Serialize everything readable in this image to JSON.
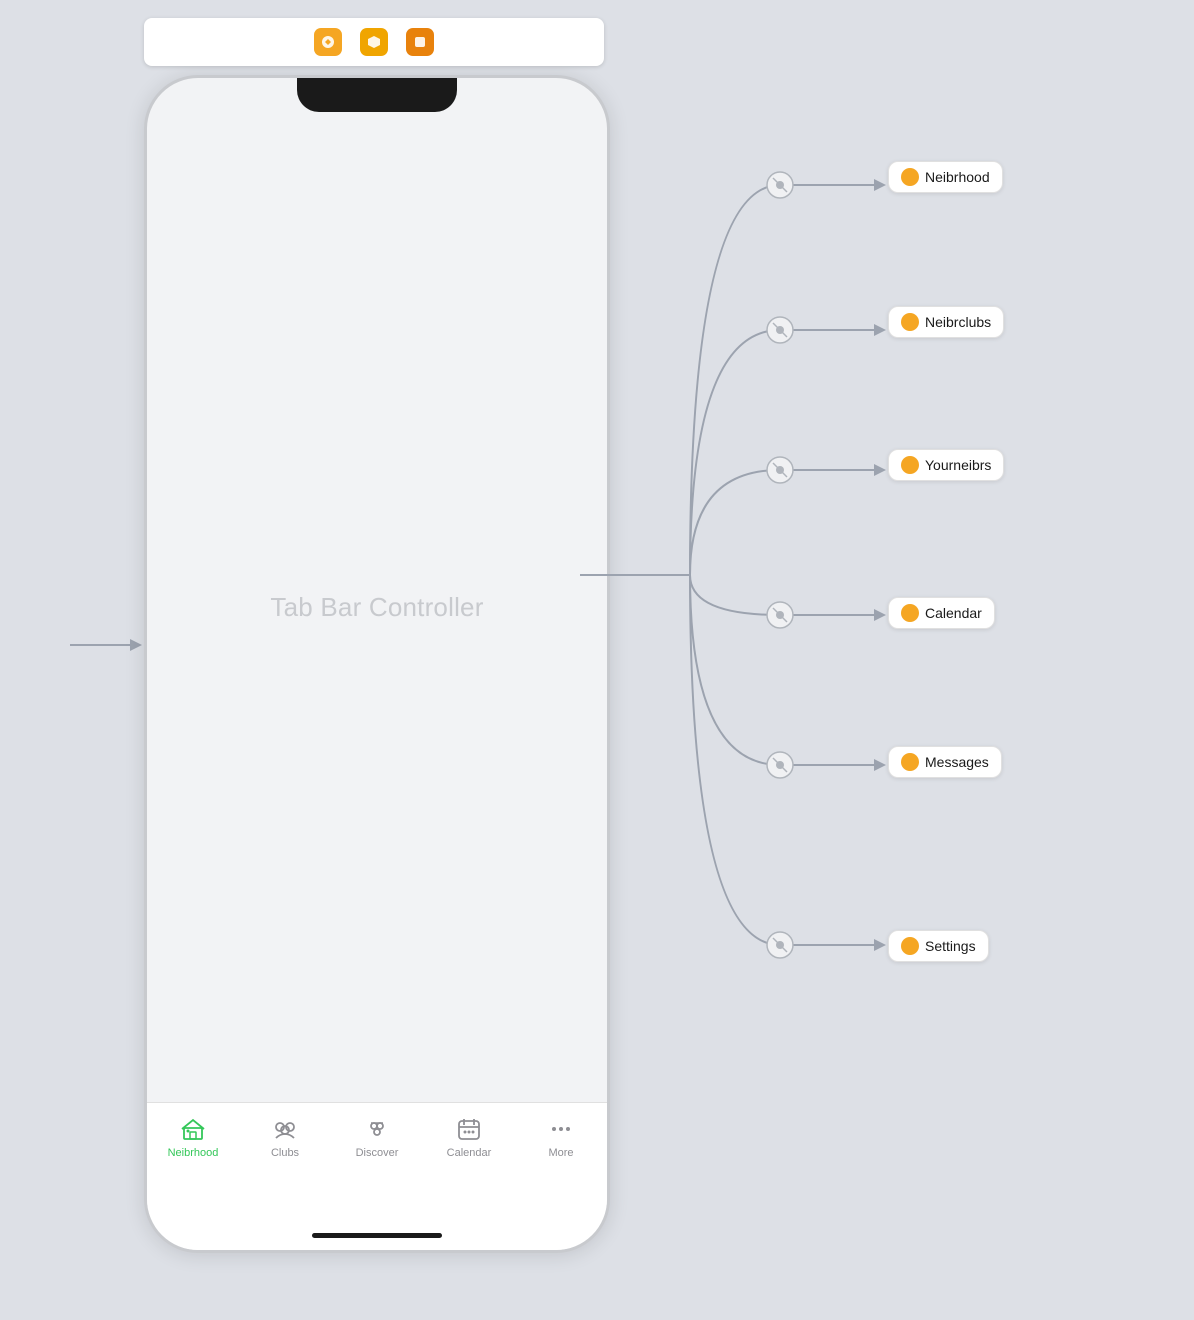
{
  "toolbar": {
    "icons": [
      {
        "name": "orange-icon",
        "color": "#f5a623",
        "symbol": "●"
      },
      {
        "name": "amber-icon",
        "color": "#f0a500",
        "symbol": "⬡"
      },
      {
        "name": "dark-orange-icon",
        "color": "#e8820c",
        "symbol": "▣"
      }
    ]
  },
  "phone": {
    "center_label": "Tab Bar Controller",
    "tabs": [
      {
        "id": "neibrhood",
        "label": "Neibrhood",
        "active": true
      },
      {
        "id": "clubs",
        "label": "Clubs",
        "active": false
      },
      {
        "id": "discover",
        "label": "Discover",
        "active": false
      },
      {
        "id": "calendar",
        "label": "Calendar",
        "active": false
      },
      {
        "id": "more",
        "label": "More",
        "active": false
      }
    ]
  },
  "nodes": [
    {
      "id": "neibrhood",
      "label": "Neibrhood"
    },
    {
      "id": "neibrclubs",
      "label": "Neibrclubs"
    },
    {
      "id": "yourneibrs",
      "label": "Yourneibrs"
    },
    {
      "id": "calendar",
      "label": "Calendar"
    },
    {
      "id": "messages",
      "label": "Messages"
    },
    {
      "id": "settings",
      "label": "Settings"
    }
  ],
  "colors": {
    "active_tab": "#34c759",
    "inactive_tab": "#8e8e93",
    "node_dot": "#f5a623",
    "line": "#9ca3af",
    "background": "#dde0e6"
  }
}
